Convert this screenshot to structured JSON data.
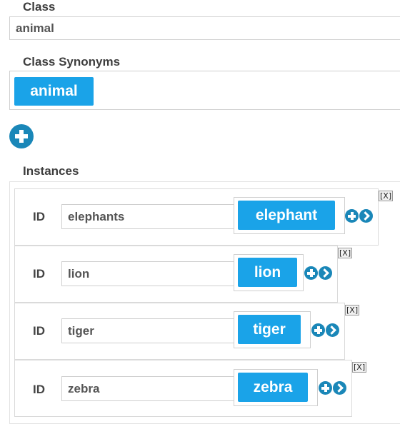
{
  "class_section": {
    "label": "Class",
    "value": "animal"
  },
  "synonyms_section": {
    "label": "Class Synonyms",
    "chips": [
      "animal"
    ]
  },
  "add_synonym": {
    "icon": "plus-circle-icon"
  },
  "instances_section": {
    "label": "Instances",
    "id_label": "ID",
    "remove_label": "[X]",
    "items": [
      {
        "id": "elephants",
        "synonym": "elephant"
      },
      {
        "id": "lion",
        "synonym": "lion"
      },
      {
        "id": "tiger",
        "synonym": "tiger"
      },
      {
        "id": "zebra",
        "synonym": "zebra"
      }
    ]
  },
  "colors": {
    "chip_blue": "#1aa3e8",
    "icon_blue": "#1a87b8"
  }
}
